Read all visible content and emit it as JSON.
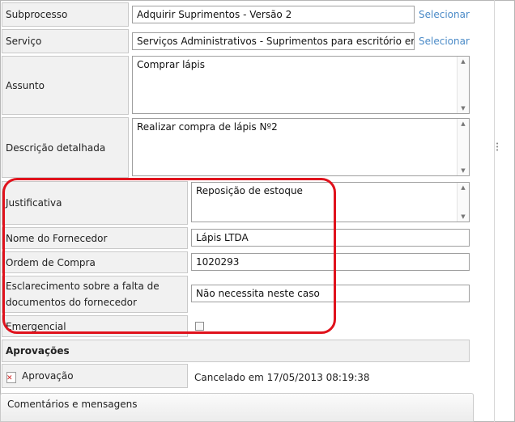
{
  "fields": {
    "subprocesso": {
      "label": "Subprocesso",
      "value": "Adquirir Suprimentos - Versão 2",
      "action": "Selecionar"
    },
    "servico": {
      "label": "Serviço",
      "value": "Serviços Administrativos - Suprimentos para escritório em",
      "action": "Selecionar"
    },
    "assunto": {
      "label": "Assunto",
      "value": "Comprar lápis"
    },
    "descricao": {
      "label": "Descrição detalhada",
      "value": "Realizar compra de lápis Nº2"
    },
    "justificativa": {
      "label": "Justificativa",
      "value": "Reposição de estoque"
    },
    "fornecedor": {
      "label": "Nome do Fornecedor",
      "value": "Lápis LTDA"
    },
    "ordem": {
      "label": "Ordem de Compra",
      "value": "1020293"
    },
    "esclarecimento": {
      "label_line1": "Esclarecimento sobre a falta de",
      "label_line2": "documentos do fornecedor",
      "value": "Não necessita neste caso"
    },
    "emergencial": {
      "label": "Emergencial",
      "checked": false
    }
  },
  "aprovacoes": {
    "title": "Aprovações",
    "item_label": "Aprovação",
    "status": "Cancelado em 17/05/2013 08:19:38"
  },
  "comentarios": {
    "title": "Comentários e mensagens"
  },
  "icons": {
    "approval": "cancelled-document-icon",
    "scroll_up": "scroll-up-icon",
    "scroll_down": "scroll-down-icon"
  },
  "colors": {
    "highlight": "#e0121c",
    "link": "#4a8ac7"
  }
}
